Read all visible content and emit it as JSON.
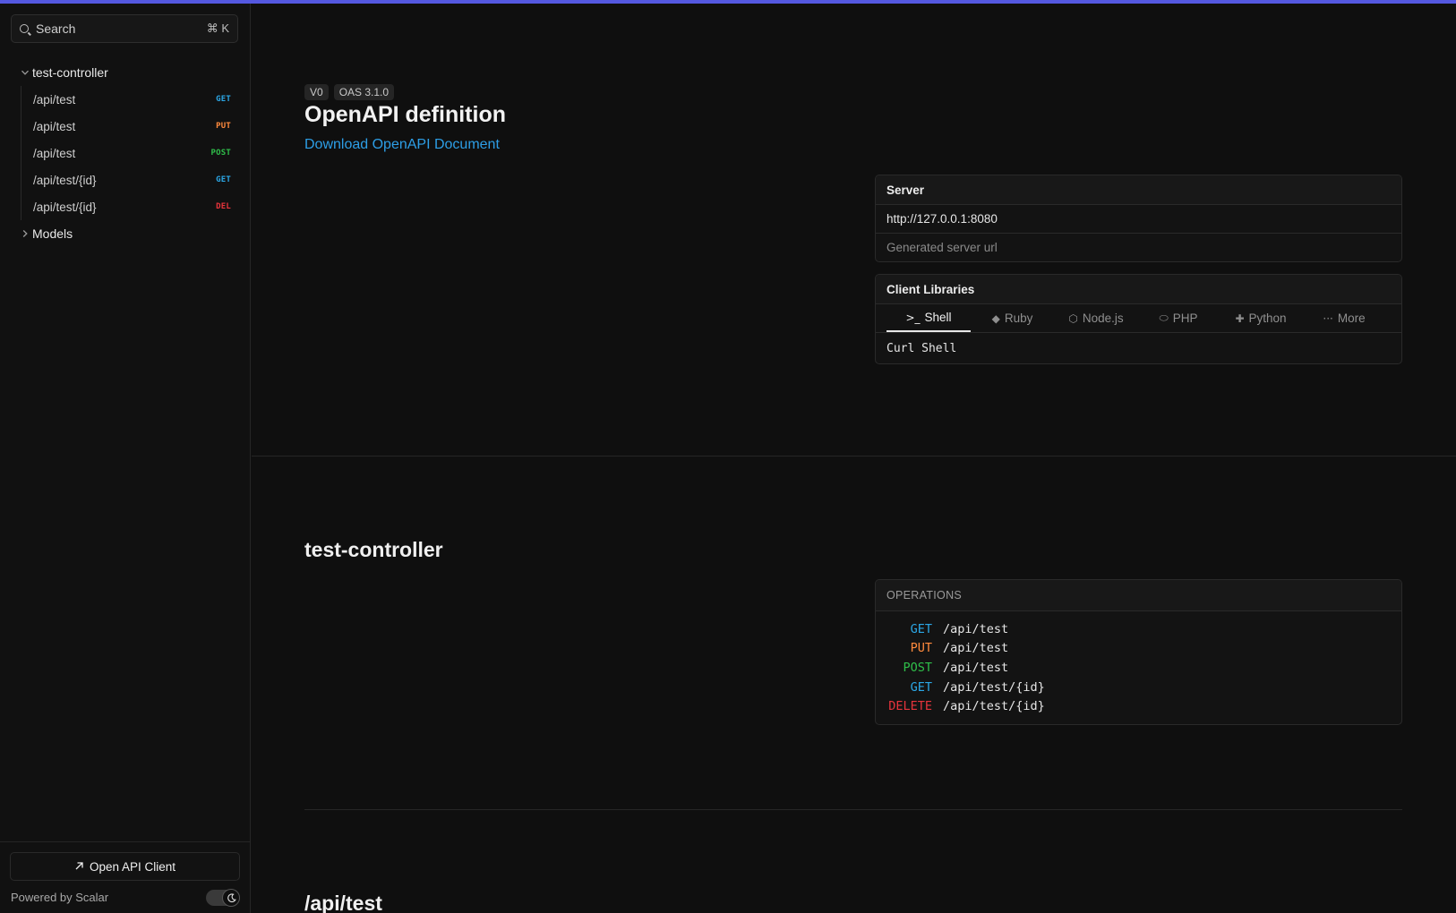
{
  "sidebar": {
    "search": {
      "placeholder": "Search",
      "shortcut": "⌘ K"
    },
    "groups": [
      {
        "label": "test-controller",
        "expanded": true,
        "items": [
          {
            "path": "/api/test",
            "method": "GET"
          },
          {
            "path": "/api/test",
            "method": "PUT"
          },
          {
            "path": "/api/test",
            "method": "POST"
          },
          {
            "path": "/api/test/{id}",
            "method": "GET"
          },
          {
            "path": "/api/test/{id}",
            "method": "DEL"
          }
        ]
      },
      {
        "label": "Models",
        "expanded": false
      }
    ],
    "footer": {
      "client_button": "Open API Client",
      "powered_by": "Powered by Scalar"
    }
  },
  "main": {
    "versions": [
      "V0",
      "OAS 3.1.0"
    ],
    "title": "OpenAPI definition",
    "download_link": "Download OpenAPI Document",
    "server": {
      "heading": "Server",
      "url": "http://127.0.0.1:8080",
      "description": "Generated server url"
    },
    "client_libraries": {
      "heading": "Client Libraries",
      "tabs": [
        {
          "label": "Shell",
          "icon": "terminal-icon",
          "active": true
        },
        {
          "label": "Ruby",
          "icon": "ruby-icon",
          "active": false
        },
        {
          "label": "Node.js",
          "icon": "nodejs-icon",
          "active": false
        },
        {
          "label": "PHP",
          "icon": "php-icon",
          "active": false
        },
        {
          "label": "Python",
          "icon": "python-icon",
          "active": false
        },
        {
          "label": "More",
          "icon": "more-icon",
          "active": false
        }
      ],
      "selected_client": "Curl Shell"
    },
    "section": {
      "title": "test-controller",
      "operations_heading": "OPERATIONS",
      "operations": [
        {
          "method": "GET",
          "path": "/api/test"
        },
        {
          "method": "PUT",
          "path": "/api/test"
        },
        {
          "method": "POST",
          "path": "/api/test"
        },
        {
          "method": "GET",
          "path": "/api/test/{id}"
        },
        {
          "method": "DELETE",
          "path": "/api/test/{id}"
        }
      ]
    },
    "next_section_title": "/api/test"
  },
  "colors": {
    "accent": "#5458e0",
    "link": "#2d9ee6",
    "get": "#2ba7e6",
    "put": "#ff8a3d",
    "post": "#2fbf4a",
    "delete": "#e8343c"
  }
}
